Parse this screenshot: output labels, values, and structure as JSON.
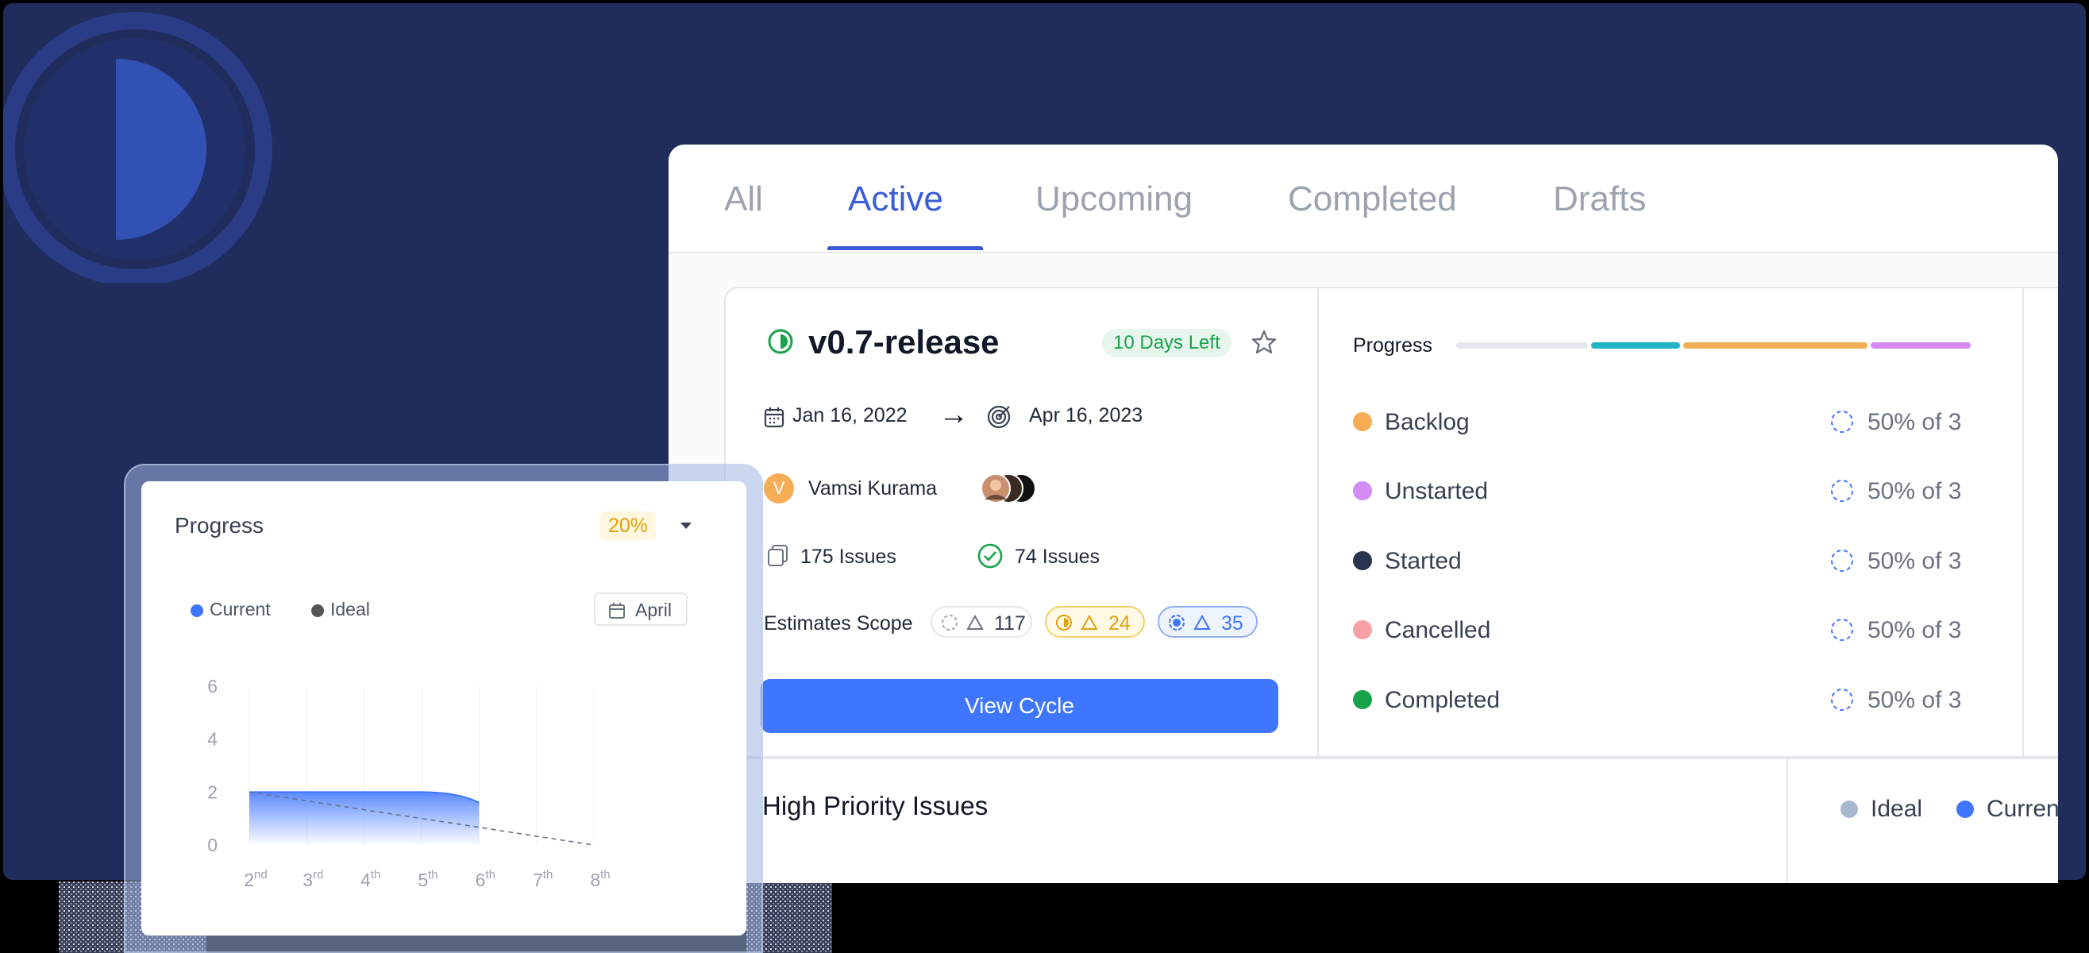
{
  "tabs": [
    {
      "label": "All",
      "active": false
    },
    {
      "label": "Active",
      "active": true
    },
    {
      "label": "Upcoming",
      "active": false
    },
    {
      "label": "Completed",
      "active": false
    },
    {
      "label": "Drafts",
      "active": false
    }
  ],
  "cycle": {
    "name": "v0.7-release",
    "days_left": "10 Days Left",
    "start_date": "Jan 16, 2022",
    "arrow": "→",
    "end_date": "Apr 16, 2023",
    "owner_initial": "V",
    "owner_name": "Vamsi Kurama",
    "total_issues": "175 Issues",
    "completed_issues": "74 Issues",
    "estimates_label": "Estimates Scope",
    "estimates": [
      "117",
      "24",
      "35"
    ],
    "view_button": "View Cycle"
  },
  "progress_panel": {
    "title": "Progress",
    "states": [
      {
        "name": "Backlog",
        "value": "50% of 3",
        "color": "#f6ad55"
      },
      {
        "name": "Unstarted",
        "value": "50% of 3",
        "color": "#d38af5"
      },
      {
        "name": "Started",
        "value": "50% of 3",
        "color": "#26344f"
      },
      {
        "name": "Cancelled",
        "value": "50% of 3",
        "color": "#f7a1a5"
      },
      {
        "name": "Completed",
        "value": "50% of 3",
        "color": "#16a34a"
      }
    ],
    "bar_colors": [
      "#e5e7eb",
      "#22b3c5",
      "#f0ad55",
      "#d38af5"
    ]
  },
  "high_priority": {
    "title": "High Priority Issues",
    "legend": [
      "Ideal",
      "Curren"
    ]
  },
  "progress_card": {
    "title": "Progress",
    "percent": "20%",
    "legend_current": "Current",
    "legend_ideal": "Ideal",
    "month": "April"
  },
  "chart_data": {
    "type": "area",
    "x": [
      "2nd",
      "3rd",
      "4th",
      "5th",
      "6th",
      "7th",
      "8th"
    ],
    "series": [
      {
        "name": "Current",
        "values": [
          2,
          2,
          2,
          2,
          1.6,
          null,
          null
        ]
      },
      {
        "name": "Ideal",
        "values": [
          2,
          1.67,
          1.33,
          1.0,
          0.67,
          0.33,
          0
        ]
      }
    ],
    "y_ticks": [
      "6",
      "4",
      "2",
      "0"
    ],
    "ylim": [
      0,
      6
    ],
    "colors": {
      "current": "#3f76ff",
      "ideal": "#6b7280"
    }
  }
}
